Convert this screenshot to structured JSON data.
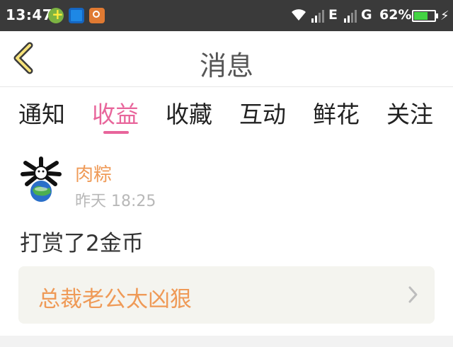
{
  "status_bar": {
    "time": "13:47",
    "network_e": "E",
    "network_g": "G",
    "battery": "62%",
    "notification_icons": [
      "app-green-plus-icon",
      "screenshot-icon",
      "media-icon"
    ]
  },
  "header": {
    "back_icon": "chevron-left-icon",
    "title": "消息"
  },
  "tabs": [
    {
      "label": "通知"
    },
    {
      "label": "收益"
    },
    {
      "label": "收藏"
    },
    {
      "label": "互动"
    },
    {
      "label": "鲜花"
    },
    {
      "label": "关注"
    }
  ],
  "active_tab": "收益",
  "message": {
    "username": "肉粽",
    "time": "昨天 18:25",
    "text": "打赏了2金币",
    "link_title": "总裁老公太凶狠"
  },
  "colors": {
    "accent": "#e8659b",
    "username": "#ef9a57",
    "status_bar_bg": "#3a3a3a",
    "link_bg": "#f4f4ef"
  }
}
